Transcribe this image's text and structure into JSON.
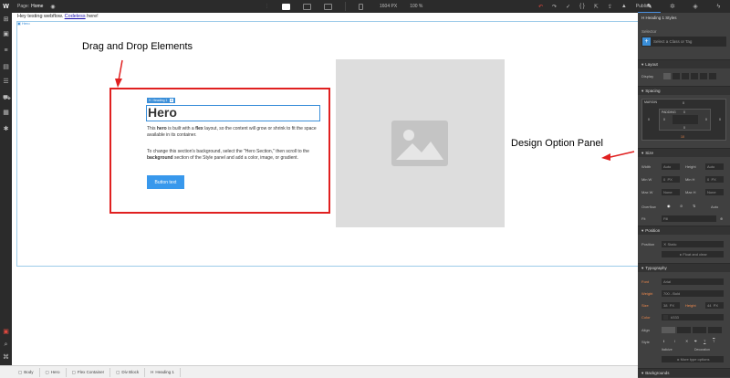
{
  "topbar": {
    "logo": "W",
    "page_label": "Page:",
    "page_name": "Home",
    "canvas_size": "1604 PX",
    "zoom": "100 %",
    "publish": "Publish"
  },
  "panel_tabs": [
    "brush-icon",
    "gear-icon",
    "drop-icon",
    "bolt-icon"
  ],
  "canvas": {
    "notice_prefix": "Hey testing webflow.",
    "notice_link": "Codeless",
    "notice_suffix": "here!",
    "hero_tag": "Hero",
    "heading_badge": "Heading 1",
    "hero_title": "Hero",
    "p1_a": "This ",
    "p1_b": "hero",
    "p1_c": " is built with a ",
    "p1_d": "flex",
    "p1_e": " layout, so the content will grow or shrink to fit the space available in its container.",
    "p2_a": "To change this section's background, select the \"Hero Section,\" then scroll to the ",
    "p2_b": "background",
    "p2_c": " section of the Style panel and add a color, image, or gradient.",
    "button_text": "Button text"
  },
  "annotations": {
    "drag_drop": "Drag and Drop Elements",
    "design_panel": "Design Option Panel"
  },
  "breadcrumbs": [
    "Body",
    "Hero",
    "Flex Container",
    "Div Block",
    "Heading 1"
  ],
  "panel": {
    "title": "Heading 1 Styles",
    "selector_label": "Selector",
    "selector_placeholder": "Select a Class or Tag",
    "layout": "Layout",
    "display_label": "Display",
    "spacing": "Spacing",
    "margin_label": "MARGIN",
    "padding_label": "PADDING",
    "zero": "0",
    "margin_bottom": "10",
    "size": "Size",
    "width_label": "Width",
    "height_label": "Height",
    "min_w": "Min W",
    "min_h": "Min H",
    "max_w": "Max W",
    "max_h": "Max H",
    "auto": "Auto",
    "none": "None",
    "px": "PX",
    "overflow_label": "Overflow",
    "overflow_auto": "Auto",
    "fit_label": "Fit",
    "fit_value": "Fill",
    "position": "Position",
    "position_label": "Position",
    "position_value": "Static",
    "float_clear": "Float and clear",
    "typography": "Typography",
    "font_label": "Font",
    "font_value": "Arial",
    "weight_label": "Weight",
    "weight_value": "700 - Bold",
    "size_label": "Size",
    "size_value": "38",
    "height_t_label": "Height",
    "height_t_value": "44",
    "color_label": "Color",
    "color_value": "#333",
    "align_label": "Align",
    "style_label": "Style",
    "italicize": "Italicize",
    "decoration": "Decoration",
    "more_type": "More type options",
    "backgrounds": "Backgrounds"
  },
  "colors": {
    "accent": "#3b8fd9",
    "annotation_red": "#e02020",
    "button_blue": "#3898ec",
    "panel_bg": "#404040",
    "orange_label": "#f0894c"
  }
}
